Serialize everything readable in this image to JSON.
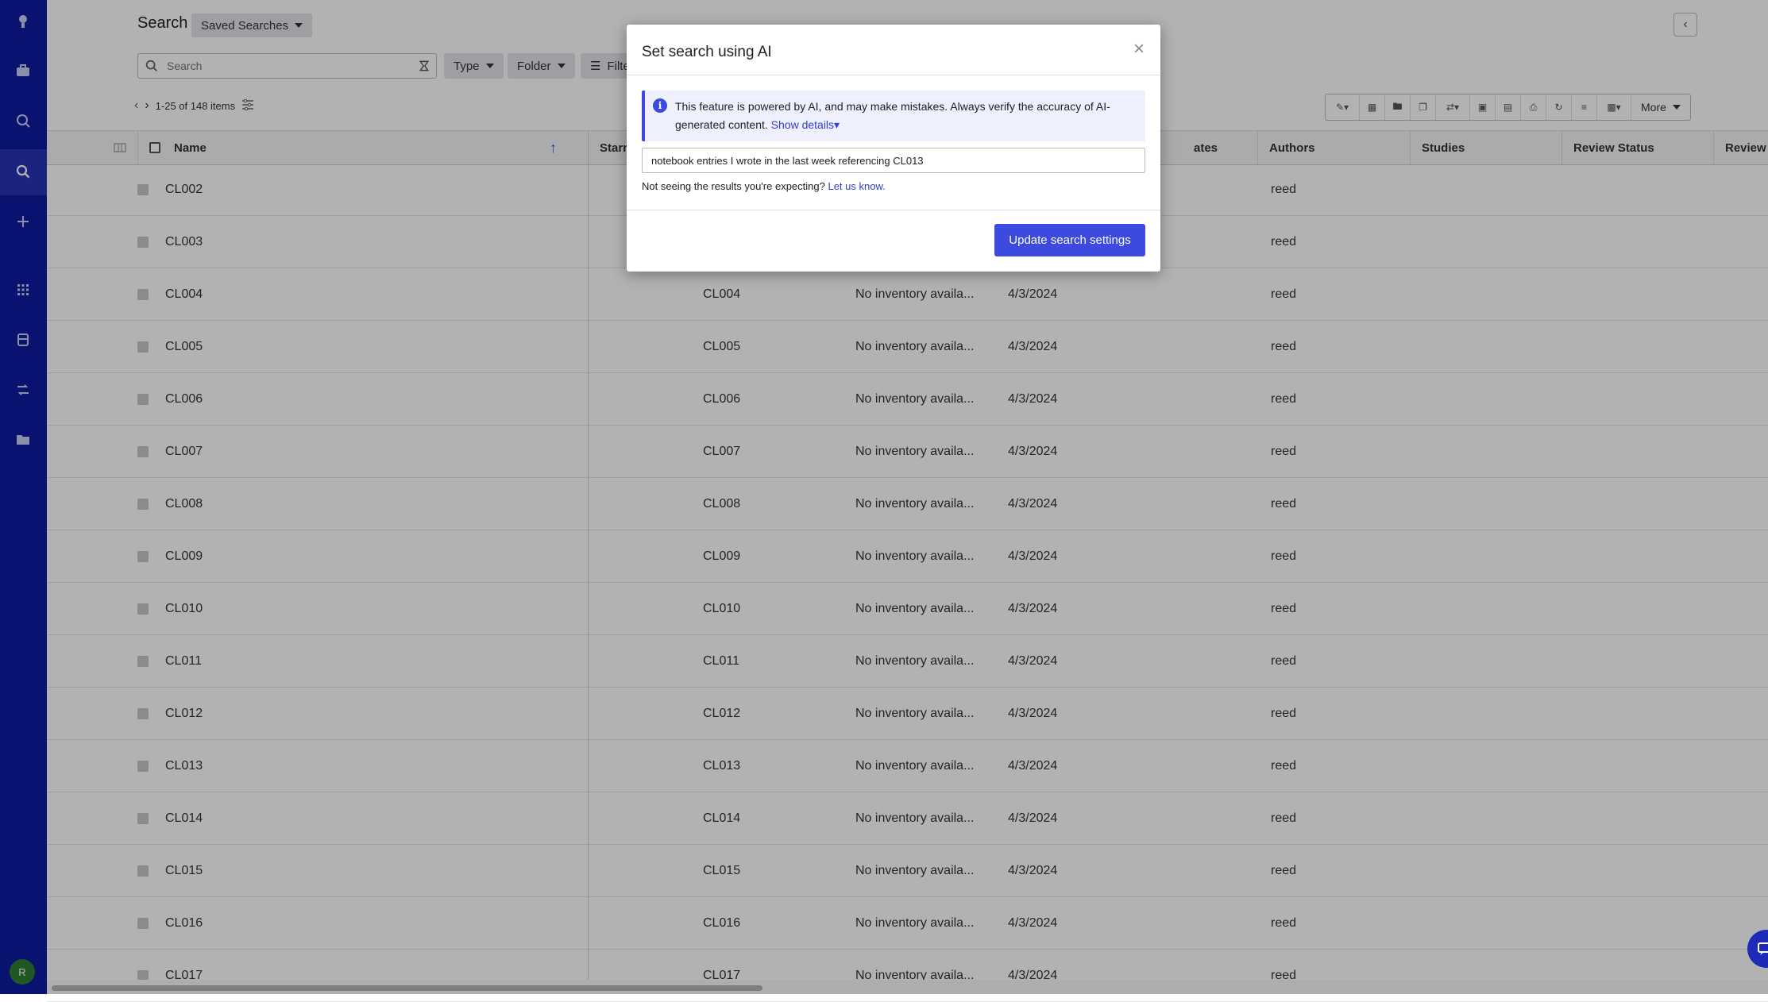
{
  "header": {
    "title": "Search",
    "saved_searches": "Saved Searches"
  },
  "search": {
    "placeholder": "Search"
  },
  "filters": {
    "type": "Type",
    "folder": "Folder",
    "filters_partial": "Filte"
  },
  "pager": {
    "range": "1-25 of 148 items"
  },
  "toolbar": {
    "more": "More"
  },
  "columns": {
    "name": "Name",
    "starred_partial": "Starr",
    "dates_partial": "ates",
    "authors": "Authors",
    "studies": "Studies",
    "review_status": "Review Status",
    "review_partial": "Review"
  },
  "rows": [
    {
      "name": "CL002",
      "id": "",
      "inventory": "",
      "date": "",
      "author": "reed"
    },
    {
      "name": "CL003",
      "id": "",
      "inventory": "",
      "date": "",
      "author": "reed"
    },
    {
      "name": "CL004",
      "id": "CL004",
      "inventory": "No inventory availa...",
      "date": "4/3/2024",
      "author": "reed"
    },
    {
      "name": "CL005",
      "id": "CL005",
      "inventory": "No inventory availa...",
      "date": "4/3/2024",
      "author": "reed"
    },
    {
      "name": "CL006",
      "id": "CL006",
      "inventory": "No inventory availa...",
      "date": "4/3/2024",
      "author": "reed"
    },
    {
      "name": "CL007",
      "id": "CL007",
      "inventory": "No inventory availa...",
      "date": "4/3/2024",
      "author": "reed"
    },
    {
      "name": "CL008",
      "id": "CL008",
      "inventory": "No inventory availa...",
      "date": "4/3/2024",
      "author": "reed"
    },
    {
      "name": "CL009",
      "id": "CL009",
      "inventory": "No inventory availa...",
      "date": "4/3/2024",
      "author": "reed"
    },
    {
      "name": "CL010",
      "id": "CL010",
      "inventory": "No inventory availa...",
      "date": "4/3/2024",
      "author": "reed"
    },
    {
      "name": "CL011",
      "id": "CL011",
      "inventory": "No inventory availa...",
      "date": "4/3/2024",
      "author": "reed"
    },
    {
      "name": "CL012",
      "id": "CL012",
      "inventory": "No inventory availa...",
      "date": "4/3/2024",
      "author": "reed"
    },
    {
      "name": "CL013",
      "id": "CL013",
      "inventory": "No inventory availa...",
      "date": "4/3/2024",
      "author": "reed"
    },
    {
      "name": "CL014",
      "id": "CL014",
      "inventory": "No inventory availa...",
      "date": "4/3/2024",
      "author": "reed"
    },
    {
      "name": "CL015",
      "id": "CL015",
      "inventory": "No inventory availa...",
      "date": "4/3/2024",
      "author": "reed"
    },
    {
      "name": "CL016",
      "id": "CL016",
      "inventory": "No inventory availa...",
      "date": "4/3/2024",
      "author": "reed"
    },
    {
      "name": "CL017",
      "id": "CL017",
      "inventory": "No inventory availa...",
      "date": "4/3/2024",
      "author": "reed"
    }
  ],
  "modal": {
    "title": "Set search using AI",
    "banner_text": "This feature is powered by AI, and may make mistakes. Always verify the accuracy of AI-generated content.",
    "show_details": "Show details",
    "query": "notebook entries I wrote in the last week referencing CL013",
    "hint": "Not seeing the results you're expecting?",
    "hint_link": "Let us know.",
    "submit": "Update search settings"
  },
  "user": {
    "initial": "R"
  },
  "colors": {
    "sidebar": "#0f1aa0",
    "accent": "#3d4ae0"
  }
}
